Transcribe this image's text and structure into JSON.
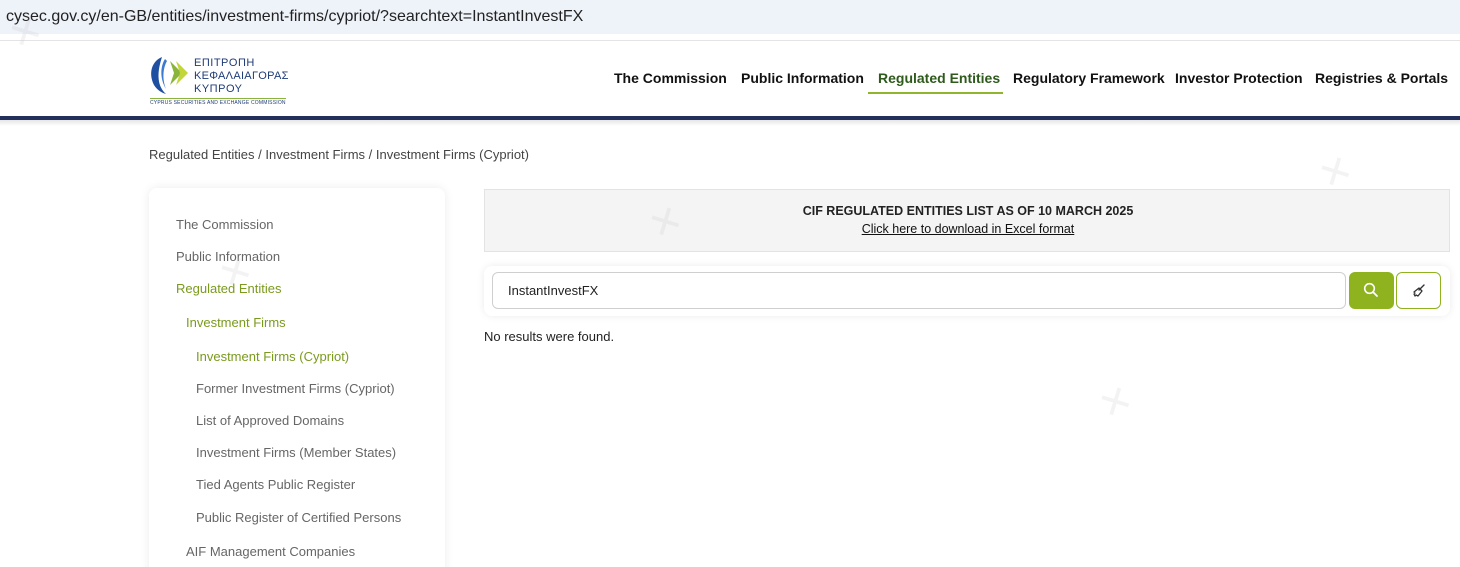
{
  "browser": {
    "url": "cysec.gov.cy/en-GB/entities/investment-firms/cypriot/?searchtext=InstantInvestFX"
  },
  "logo": {
    "line1": "ΕΠΙΤΡΟΠΗ",
    "line2": "ΚΕΦΑΛΑΙΑΓΟΡΑΣ",
    "line3": "ΚΥΠΡΟΥ",
    "line4": "CYPRUS SECURITIES AND EXCHANGE COMMISSION"
  },
  "nav": {
    "items": [
      {
        "label": "The Commission",
        "active": false
      },
      {
        "label": "Public Information",
        "active": false
      },
      {
        "label": "Regulated Entities",
        "active": true
      },
      {
        "label": "Regulatory Framework",
        "active": false
      },
      {
        "label": "Investor Protection",
        "active": false
      },
      {
        "label": "Registries & Portals",
        "active": false
      }
    ]
  },
  "breadcrumb": "Regulated Entities / Investment Firms / Investment Firms (Cypriot)",
  "sidebar": {
    "items": [
      {
        "label": "The Commission",
        "active": false
      },
      {
        "label": "Public Information",
        "active": false
      },
      {
        "label": "Regulated Entities",
        "active": true
      },
      {
        "label": "Investment Firms",
        "active": true
      },
      {
        "label": "Investment Firms (Cypriot)",
        "active": true
      },
      {
        "label": "Former Investment Firms (Cypriot)",
        "active": false
      },
      {
        "label": "List of Approved Domains",
        "active": false
      },
      {
        "label": "Investment Firms (Member States)",
        "active": false
      },
      {
        "label": "Tied Agents Public Register",
        "active": false
      },
      {
        "label": "Public Register of Certified Persons",
        "active": false
      },
      {
        "label": "AIF Management Companies",
        "active": false
      }
    ]
  },
  "banner": {
    "title": "CIF REGULATED ENTITIES LIST AS OF 10 MARCH 2025",
    "link": "Click here to download in Excel format"
  },
  "search": {
    "value": "InstantInvestFX"
  },
  "results": {
    "message": "No results were found."
  },
  "colors": {
    "accent": "#8fb31e",
    "navy": "#23305a",
    "active_text": "#7a9a1e"
  }
}
